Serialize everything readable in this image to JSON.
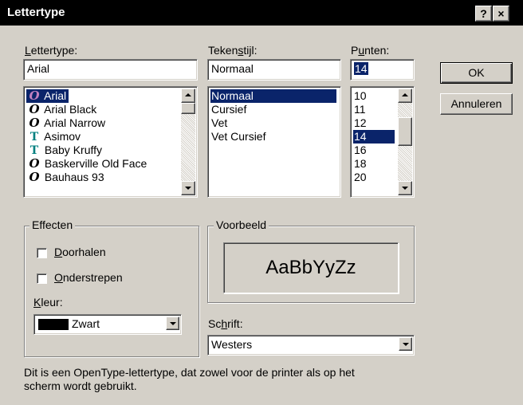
{
  "window": {
    "title": "Lettertype",
    "help_label": "?",
    "close_label": "×"
  },
  "font": {
    "label": "Lettertype:",
    "value": "Arial",
    "items": [
      {
        "icon": "opentype",
        "name": "Arial"
      },
      {
        "icon": "opentype",
        "name": "Arial Black"
      },
      {
        "icon": "opentype",
        "name": "Arial Narrow"
      },
      {
        "icon": "truetype",
        "name": "Asimov"
      },
      {
        "icon": "truetype",
        "name": "Baby Kruffy"
      },
      {
        "icon": "opentype",
        "name": "Baskerville Old Face"
      },
      {
        "icon": "opentype",
        "name": "Bauhaus 93"
      }
    ],
    "selected_index": 0
  },
  "style": {
    "label": "Tekenstijl:",
    "value": "Normaal",
    "items": [
      "Normaal",
      "Cursief",
      "Vet",
      "Vet Cursief"
    ],
    "selected_index": 0
  },
  "size": {
    "label": "Punten:",
    "value": "14",
    "items": [
      "10",
      "11",
      "12",
      "14",
      "16",
      "18",
      "20"
    ],
    "selected_index": 3
  },
  "buttons": {
    "ok": "OK",
    "cancel": "Annuleren"
  },
  "effects": {
    "title": "Effecten",
    "strikeout": "Doorhalen",
    "strikeout_checked": false,
    "underline": "Onderstrepen",
    "underline_checked": false,
    "color_label": "Kleur:",
    "color_value": "Zwart",
    "color_swatch": "#000000"
  },
  "preview": {
    "title": "Voorbeeld",
    "sample": "AaBbYyZz"
  },
  "script": {
    "label": "Schrift:",
    "value": "Westers"
  },
  "description": {
    "line1": "Dit is een OpenType-lettertype, dat zowel voor de printer als op het",
    "line2": "scherm wordt gebruikt."
  },
  "colors": {
    "selection": "#0a246a",
    "dialog_bg": "#d4d0c8",
    "opentype_icon": "#000000",
    "truetype_icon": "#008080"
  },
  "icons": {
    "opentype": "opentype-icon",
    "truetype": "truetype-icon"
  }
}
